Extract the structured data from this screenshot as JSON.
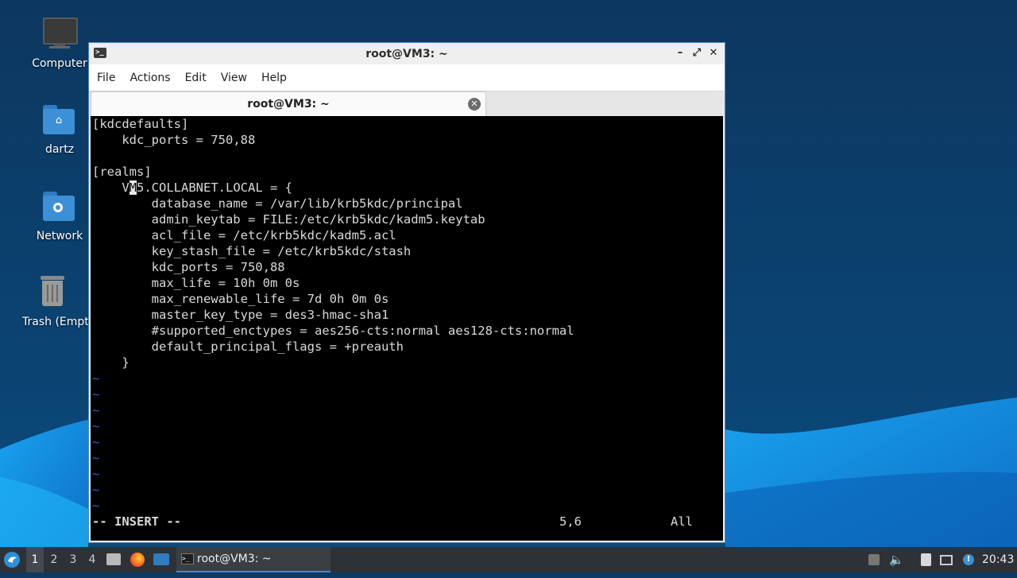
{
  "desktop": {
    "icons": [
      {
        "label": "Computer"
      },
      {
        "label": "dartz"
      },
      {
        "label": "Network"
      },
      {
        "label": "Trash (Empty)"
      }
    ]
  },
  "window": {
    "title": "root@VM3: ~",
    "controls": {
      "minimize": "–",
      "maximize": "⤢",
      "close": "✕"
    },
    "menu": [
      "File",
      "Actions",
      "Edit",
      "View",
      "Help"
    ],
    "tab": {
      "label": "root@VM3: ~",
      "close": "✕"
    }
  },
  "terminal": {
    "lines": [
      "[kdcdefaults]",
      "    kdc_ports = 750,88",
      "",
      "[realms]",
      "    VM5.COLLABNET.LOCAL = {",
      "        database_name = /var/lib/krb5kdc/principal",
      "        admin_keytab = FILE:/etc/krb5kdc/kadm5.keytab",
      "        acl_file = /etc/krb5kdc/kadm5.acl",
      "        key_stash_file = /etc/krb5kdc/stash",
      "        kdc_ports = 750,88",
      "        max_life = 10h 0m 0s",
      "        max_renewable_life = 7d 0h 0m 0s",
      "        master_key_type = des3-hmac-sha1",
      "        #supported_enctypes = aes256-cts:normal aes128-cts:normal",
      "        default_principal_flags = +preauth",
      "    }"
    ],
    "cursor_line": {
      "before": "    V",
      "cursor_char": "M",
      "after": "5.COLLABNET.LOCAL = {"
    },
    "tilde_marker": "~",
    "tilde_count": 9,
    "status": {
      "mode": "-- INSERT --",
      "position": "5,6",
      "scroll": "All"
    }
  },
  "taskbar": {
    "workspaces": [
      "1",
      "2",
      "3",
      "4"
    ],
    "active_workspace": "1",
    "task": {
      "label": "root@VM3: ~"
    },
    "clock": "20:43"
  },
  "colors": {
    "accent": "#4f87c8",
    "terminal_bg": "#000000",
    "tilde": "#3b57c9",
    "folder": "#3d8fd6"
  }
}
